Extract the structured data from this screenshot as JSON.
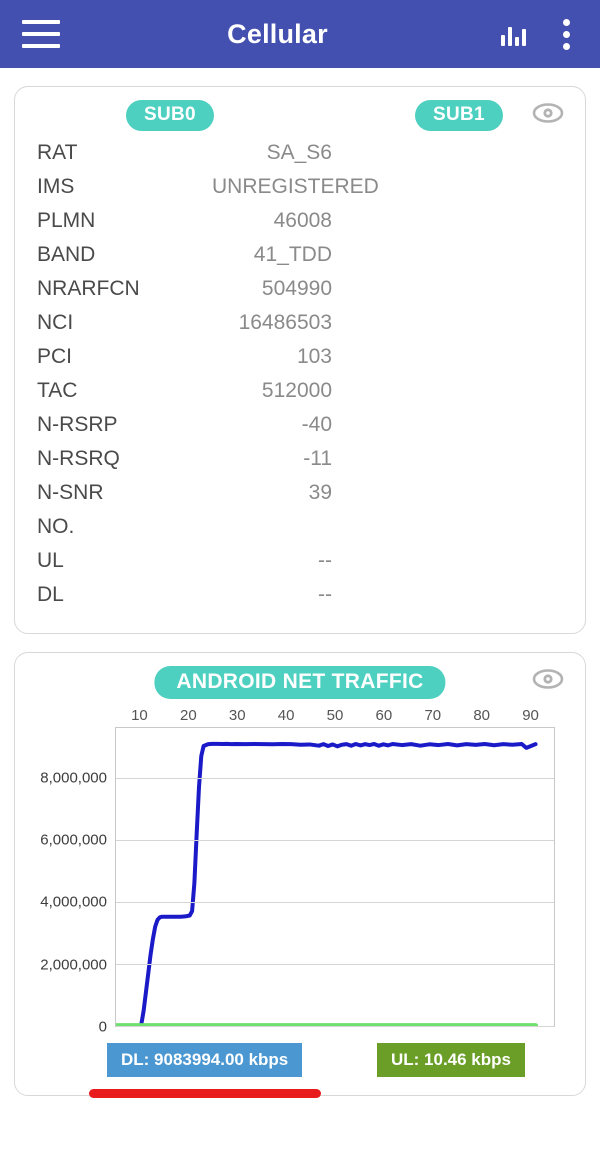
{
  "appbar": {
    "title": "Cellular",
    "menu_icon": "hamburger-menu-icon",
    "chart_icon": "bar-chart-icon",
    "overflow_icon": "more-vertical-icon"
  },
  "sim_card": {
    "sub0_label": "SUB0",
    "sub1_label": "SUB1",
    "visibility_icon": "eye-icon",
    "rows": [
      {
        "label": "RAT",
        "sub0": "SA_S6",
        "sub1": ""
      },
      {
        "label": "IMS",
        "sub0": "UNREGISTERED",
        "sub1": ""
      },
      {
        "label": "PLMN",
        "sub0": "46008",
        "sub1": ""
      },
      {
        "label": "BAND",
        "sub0": "41_TDD",
        "sub1": ""
      },
      {
        "label": "NRARFCN",
        "sub0": "504990",
        "sub1": ""
      },
      {
        "label": "NCI",
        "sub0": "16486503",
        "sub1": ""
      },
      {
        "label": "PCI",
        "sub0": "103",
        "sub1": ""
      },
      {
        "label": "TAC",
        "sub0": "512000",
        "sub1": ""
      },
      {
        "label": "N-RSRP",
        "sub0": "-40",
        "sub1": ""
      },
      {
        "label": "N-RSRQ",
        "sub0": "-11",
        "sub1": ""
      },
      {
        "label": "N-SNR",
        "sub0": "39",
        "sub1": ""
      },
      {
        "label": "NO.",
        "sub0": "",
        "sub1": ""
      },
      {
        "label": "UL",
        "sub0": "--",
        "sub1": ""
      },
      {
        "label": "DL",
        "sub0": "--",
        "sub1": ""
      }
    ]
  },
  "traffic_card": {
    "title": "ANDROID NET TRAFFIC",
    "visibility_icon": "eye-icon",
    "dl_legend": "DL: 9083994.00 kbps",
    "ul_legend": "UL: 10.46 kbps",
    "dl_color": "#4a97d2",
    "ul_color": "#6a9e27",
    "highlight_color": "#e81c1c"
  },
  "colors": {
    "appbar": "#4350b0",
    "pill": "#4dd0c0",
    "dl_line": "#1a1ac8",
    "ul_line": "#6de06d"
  },
  "chart_data": {
    "type": "line",
    "title": "ANDROID NET TRAFFIC",
    "xlabel": "",
    "ylabel": "",
    "xlim": [
      0,
      95
    ],
    "ylim": [
      0,
      9600000
    ],
    "grid": true,
    "legend_position": "bottom",
    "xticks": [
      10,
      20,
      30,
      40,
      50,
      60,
      70,
      80,
      90
    ],
    "yticks": [
      0,
      2000000,
      4000000,
      6000000,
      8000000
    ],
    "ytick_labels": [
      "0",
      "2,000,000",
      "4,000,000",
      "6,000,000",
      "8,000,000"
    ],
    "series": [
      {
        "name": "DL",
        "color": "#1a1ac8",
        "x": [
          5.5,
          6,
          6.5,
          7,
          7.5,
          8,
          8.5,
          9,
          9.5,
          10,
          11,
          12,
          13,
          14,
          15,
          16,
          16.5,
          17,
          17.5,
          18,
          18.5,
          19,
          20,
          21,
          22,
          23,
          24,
          25,
          26,
          28,
          30,
          32,
          34,
          36,
          38,
          40,
          42,
          44,
          45,
          46,
          47,
          48,
          49,
          50,
          51,
          52,
          53,
          54,
          55,
          56,
          57,
          58,
          59,
          60,
          62,
          64,
          66,
          68,
          70,
          72,
          74,
          76,
          78,
          80,
          82,
          84,
          86,
          88,
          89,
          90,
          91
        ],
        "y": [
          60000,
          500000,
          1100000,
          1700000,
          2300000,
          2800000,
          3200000,
          3420000,
          3500000,
          3520000,
          3520000,
          3520000,
          3520000,
          3520000,
          3530000,
          3560000,
          3700000,
          4600000,
          6200000,
          7700000,
          8700000,
          9020000,
          9080000,
          9090000,
          9090000,
          9085000,
          9090000,
          9080000,
          9085000,
          9080000,
          9085000,
          9080000,
          9075000,
          9085000,
          9080000,
          9060000,
          9070000,
          9030000,
          9080000,
          9020000,
          9070000,
          9010000,
          9060000,
          9080000,
          9030000,
          9085000,
          9040000,
          9080000,
          9050000,
          9085000,
          9030000,
          9075000,
          9040000,
          9085000,
          9050000,
          9080000,
          9030000,
          9075000,
          9050000,
          9085000,
          9040000,
          9080000,
          9055000,
          9085000,
          9045000,
          9080000,
          9060000,
          9085000,
          8960000,
          9020000,
          9080000
        ]
      },
      {
        "name": "UL",
        "color": "#6de06d",
        "x": [
          0,
          91
        ],
        "y": [
          10460,
          10460
        ]
      }
    ]
  }
}
